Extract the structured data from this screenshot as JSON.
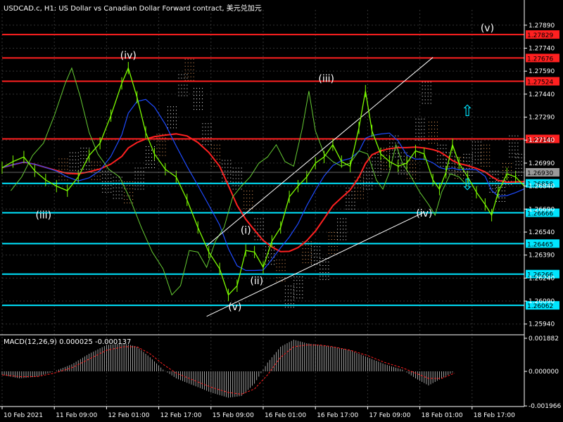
{
  "window": {
    "title": "USDCAD.c, H1:  US Dollar vs Canadian Dollar Forward contract, 美元兑加元"
  },
  "colors": {
    "background": "#000000",
    "price": "#7CFC00",
    "red_level": "#FF2020",
    "cyan_level": "#00E5FF",
    "moving_average_red": "#FF2020",
    "moving_average_blue": "#1E4BFF",
    "channel": "#FFFFFF",
    "lagging": "#66CC33",
    "cloud_up": "#FFFFFF",
    "cloud_down": "#F4A460",
    "macd_hist": "#C8C8C8",
    "macd_signal": "#FF2020"
  },
  "chart_data": [
    {
      "type": "line",
      "panel": "price",
      "ylim": [
        1.2587,
        1.2799
      ],
      "y_ticks": [
        "1.27890",
        "1.27740",
        "1.27590",
        "1.27440",
        "1.27290",
        "1.27140",
        "1.26990",
        "1.26840",
        "1.26690",
        "1.26540",
        "1.26390",
        "1.26240",
        "1.26090",
        "1.25940"
      ],
      "x_ticks": [
        "10 Feb 2021",
        "11 Feb 09:00",
        "12 Feb 01:00",
        "12 Feb 17:00",
        "15 Feb 09:00",
        "16 Feb 01:00",
        "16 Feb 17:00",
        "17 Feb 09:00",
        "18 Feb 01:00",
        "18 Feb 17:00"
      ],
      "current_price": "1.26930",
      "price_series": [
        [
          0,
          1.2696
        ],
        [
          5,
          1.27
        ],
        [
          10,
          1.2703
        ],
        [
          15,
          1.2694
        ],
        [
          20,
          1.2688
        ],
        [
          25,
          1.2684
        ],
        [
          30,
          1.2681
        ],
        [
          35,
          1.269
        ],
        [
          40,
          1.2704
        ],
        [
          45,
          1.2712
        ],
        [
          50,
          1.273
        ],
        [
          55,
          1.2751
        ],
        [
          58,
          1.2761
        ],
        [
          62,
          1.2742
        ],
        [
          66,
          1.2719
        ],
        [
          70,
          1.2705
        ],
        [
          75,
          1.2695
        ],
        [
          80,
          1.269
        ],
        [
          85,
          1.2675
        ],
        [
          90,
          1.2657
        ],
        [
          95,
          1.2641
        ],
        [
          100,
          1.263
        ],
        [
          104,
          1.2613
        ],
        [
          108,
          1.2619
        ],
        [
          112,
          1.2642
        ],
        [
          116,
          1.2641
        ],
        [
          120,
          1.2631
        ],
        [
          124,
          1.2648
        ],
        [
          128,
          1.2657
        ],
        [
          132,
          1.2677
        ],
        [
          136,
          1.2684
        ],
        [
          140,
          1.269
        ],
        [
          144,
          1.2699
        ],
        [
          148,
          1.2703
        ],
        [
          152,
          1.2711
        ],
        [
          156,
          1.27
        ],
        [
          160,
          1.2697
        ],
        [
          164,
          1.2722
        ],
        [
          167,
          1.2746
        ],
        [
          170,
          1.272
        ],
        [
          174,
          1.2705
        ],
        [
          178,
          1.27
        ],
        [
          182,
          1.2697
        ],
        [
          186,
          1.2699
        ],
        [
          190,
          1.2707
        ],
        [
          194,
          1.2705
        ],
        [
          198,
          1.2688
        ],
        [
          201,
          1.2682
        ],
        [
          204,
          1.2693
        ],
        [
          207,
          1.2711
        ],
        [
          210,
          1.2699
        ],
        [
          214,
          1.269
        ],
        [
          218,
          1.268
        ],
        [
          222,
          1.2672
        ],
        [
          225,
          1.2665
        ],
        [
          228,
          1.268
        ],
        [
          232,
          1.2692
        ],
        [
          236,
          1.269
        ],
        [
          240,
          1.2684
        ]
      ],
      "horizontal_levels": [
        {
          "value": "1.27829",
          "color": "red"
        },
        {
          "value": "1.27676",
          "color": "red"
        },
        {
          "value": "1.27524",
          "color": "red"
        },
        {
          "value": "1.27148",
          "color": "red"
        },
        {
          "value": "1.26858",
          "color": "cyan"
        },
        {
          "value": "1.26666",
          "color": "cyan"
        },
        {
          "value": "1.26465",
          "color": "cyan"
        },
        {
          "value": "1.26266",
          "color": "cyan"
        },
        {
          "value": "1.26062",
          "color": "cyan"
        }
      ],
      "annotations": [
        {
          "text": "(iv)",
          "x": 58,
          "y": 1.2767
        },
        {
          "text": "(iii)",
          "x": 19,
          "y": 1.2663
        },
        {
          "text": "(iii)",
          "x": 149,
          "y": 1.2752
        },
        {
          "text": "(v)",
          "x": 223,
          "y": 1.2785
        },
        {
          "text": "(i)",
          "x": 112,
          "y": 1.2653
        },
        {
          "text": "(ii)",
          "x": 117,
          "y": 1.262
        },
        {
          "text": "(v)",
          "x": 107,
          "y": 1.2603
        },
        {
          "text": "(iv)",
          "x": 194,
          "y": 1.2664
        }
      ],
      "channel": {
        "lower": [
          [
            94,
            1.2599
          ],
          [
            194,
            1.2667
          ]
        ],
        "upper": [
          [
            94,
            1.2645
          ],
          [
            198,
            1.2768
          ]
        ]
      }
    },
    {
      "type": "bar",
      "panel": "indicator",
      "title": "MACD(12,26,9) 0.000025 -0.000137",
      "ylim": [
        -0.002,
        0.002
      ],
      "y_ticks": [
        "0.001882",
        "0.000000",
        "-0.001966"
      ],
      "histogram": [
        [
          0,
          -0.0002
        ],
        [
          8,
          -0.0004
        ],
        [
          16,
          -0.0003
        ],
        [
          24,
          0.0
        ],
        [
          32,
          0.0004
        ],
        [
          40,
          0.001
        ],
        [
          48,
          0.0015
        ],
        [
          56,
          0.0016
        ],
        [
          62,
          0.0014
        ],
        [
          68,
          0.0008
        ],
        [
          74,
          0.0001
        ],
        [
          80,
          -0.0004
        ],
        [
          88,
          -0.0008
        ],
        [
          96,
          -0.0012
        ],
        [
          104,
          -0.0015
        ],
        [
          110,
          -0.0014
        ],
        [
          116,
          -0.0007
        ],
        [
          122,
          0.0005
        ],
        [
          128,
          0.0014
        ],
        [
          134,
          0.0018
        ],
        [
          140,
          0.0016
        ],
        [
          146,
          0.0015
        ],
        [
          152,
          0.0014
        ],
        [
          160,
          0.0012
        ],
        [
          168,
          0.0008
        ],
        [
          176,
          0.0004
        ],
        [
          184,
          0.0001
        ],
        [
          190,
          -0.0004
        ],
        [
          196,
          -0.0008
        ],
        [
          202,
          -0.0004
        ],
        [
          208,
          0.0
        ]
      ],
      "signal": [
        [
          0,
          -0.0002
        ],
        [
          8,
          -0.0003
        ],
        [
          16,
          -0.0003
        ],
        [
          24,
          -0.0001
        ],
        [
          32,
          0.0002
        ],
        [
          40,
          0.0007
        ],
        [
          48,
          0.0012
        ],
        [
          56,
          0.0014
        ],
        [
          62,
          0.0014
        ],
        [
          68,
          0.001
        ],
        [
          74,
          0.0004
        ],
        [
          80,
          -0.0001
        ],
        [
          88,
          -0.0005
        ],
        [
          96,
          -0.0009
        ],
        [
          104,
          -0.0012
        ],
        [
          110,
          -0.0013
        ],
        [
          116,
          -0.001
        ],
        [
          122,
          -0.0002
        ],
        [
          128,
          0.0008
        ],
        [
          134,
          0.0014
        ],
        [
          140,
          0.0015
        ],
        [
          146,
          0.0015
        ],
        [
          152,
          0.0014
        ],
        [
          160,
          0.0012
        ],
        [
          168,
          0.0009
        ],
        [
          176,
          0.0005
        ],
        [
          184,
          0.0002
        ],
        [
          190,
          -0.0001
        ],
        [
          196,
          -0.0004
        ],
        [
          202,
          -0.0004
        ],
        [
          208,
          -0.0001
        ]
      ]
    }
  ]
}
